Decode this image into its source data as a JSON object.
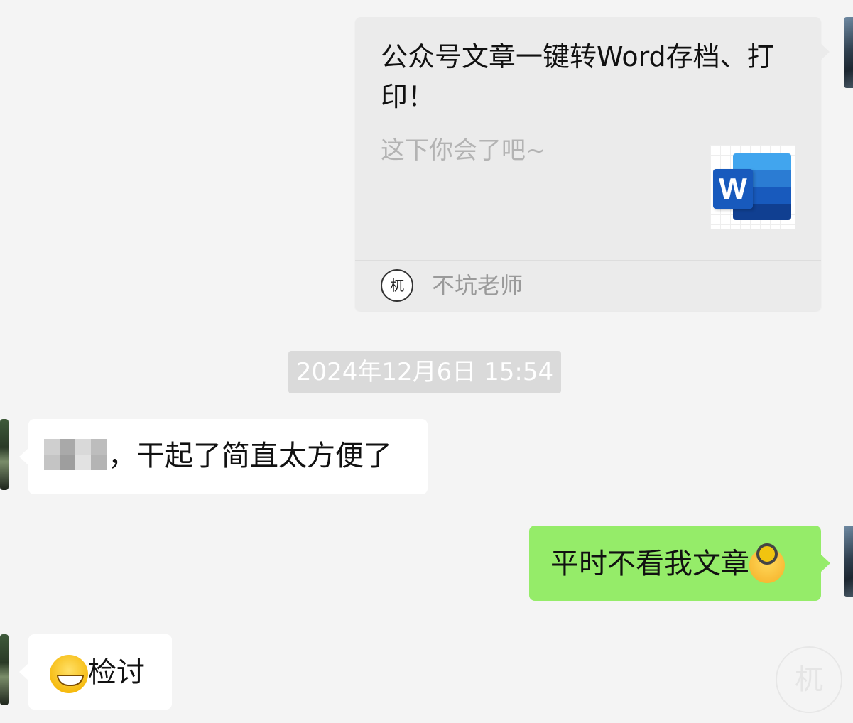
{
  "chat": {
    "article_card": {
      "title": "公众号文章一键转Word存档、打印！",
      "description": "这下你会了吧~",
      "source_name": "不坑老师",
      "thumbnail_icon": "word-doc-icon",
      "thumbnail_letter": "W",
      "source_logo_letter": "杌"
    },
    "timestamp": "2024年12月6日 15:54",
    "messages": [
      {
        "side": "received",
        "text": "，干起了简直太方便了",
        "has_redacted_name": true
      },
      {
        "side": "sent",
        "text": "平时不看我文章",
        "emoji": "covered-eyes-emoji"
      },
      {
        "side": "received",
        "text": "检讨",
        "emoji": "grinning-face-emoji"
      }
    ],
    "watermark_letter": "杌"
  },
  "colors": {
    "background": "#f4f4f4",
    "card_bg": "#ebebeb",
    "sent_bubble": "#95ec69",
    "received_bubble": "#ffffff",
    "timestamp_bg": "#dadada",
    "word_blue": "#185abd"
  }
}
